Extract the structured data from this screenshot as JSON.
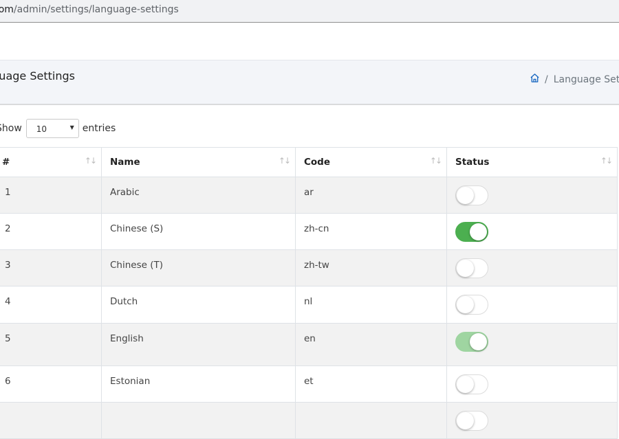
{
  "browser": {
    "url_host": "com",
    "url_path": "/admin/settings/language-settings"
  },
  "header": {
    "title": "nguage Settings",
    "breadcrumb_current": "Language Setti",
    "breadcrumb_separator": "/"
  },
  "length_control": {
    "show_label": "Show",
    "selected": "10",
    "entries_label": "entries"
  },
  "table": {
    "columns": [
      "#",
      "Name",
      "Code",
      "Status"
    ],
    "rows": [
      {
        "num": "1",
        "name": "Arabic",
        "code": "ar",
        "status": "off"
      },
      {
        "num": "2",
        "name": "Chinese (S)",
        "code": "zh-cn",
        "status": "on"
      },
      {
        "num": "3",
        "name": "Chinese (T)",
        "code": "zh-tw",
        "status": "off"
      },
      {
        "num": "4",
        "name": "Dutch",
        "code": "nl",
        "status": "off"
      },
      {
        "num": "5",
        "name": "English",
        "code": "en",
        "status": "on-disabled"
      },
      {
        "num": "6",
        "name": "Estonian",
        "code": "et",
        "status": "off"
      },
      {
        "num": "",
        "name": "",
        "code": "",
        "status": "off"
      }
    ]
  },
  "colors": {
    "toggle_on": "#4caf50",
    "toggle_on_disabled": "#9fd5a1",
    "breadcrumb_home_icon": "#1565c0"
  },
  "icons": {
    "breadcrumb": "home-icon",
    "menu": "menu-icon",
    "sort": "sort-icon"
  }
}
